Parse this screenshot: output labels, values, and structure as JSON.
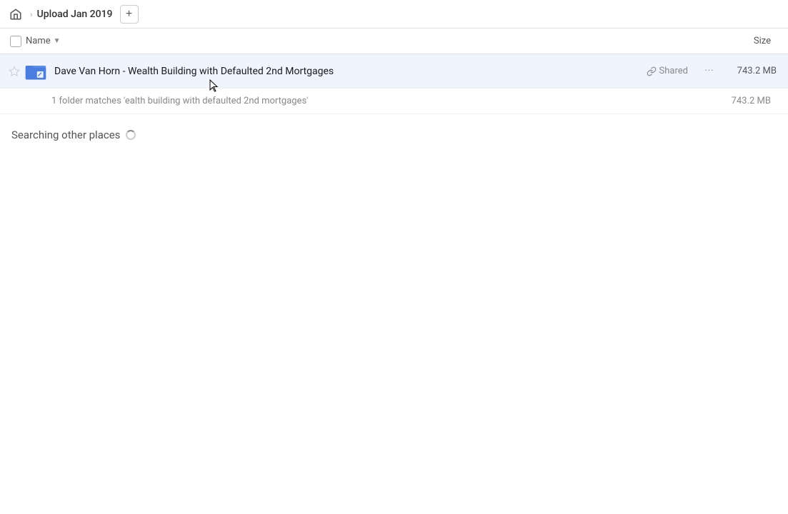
{
  "header": {
    "breadcrumb_title": "Upload Jan 2019",
    "add_button_label": "+",
    "home_icon": "home-icon",
    "chevron_icon": "›"
  },
  "columns": {
    "name_label": "Name",
    "size_label": "Size"
  },
  "file_row": {
    "name": "Dave Van Horn - Wealth Building with Defaulted 2nd Mortgages",
    "shared_label": "Shared",
    "size": "743.2 MB",
    "more_icon": "···"
  },
  "match_row": {
    "text": "1 folder matches 'ealth building with defaulted 2nd mortgages'",
    "size": "743.2 MB"
  },
  "searching_section": {
    "label": "Searching other places"
  }
}
